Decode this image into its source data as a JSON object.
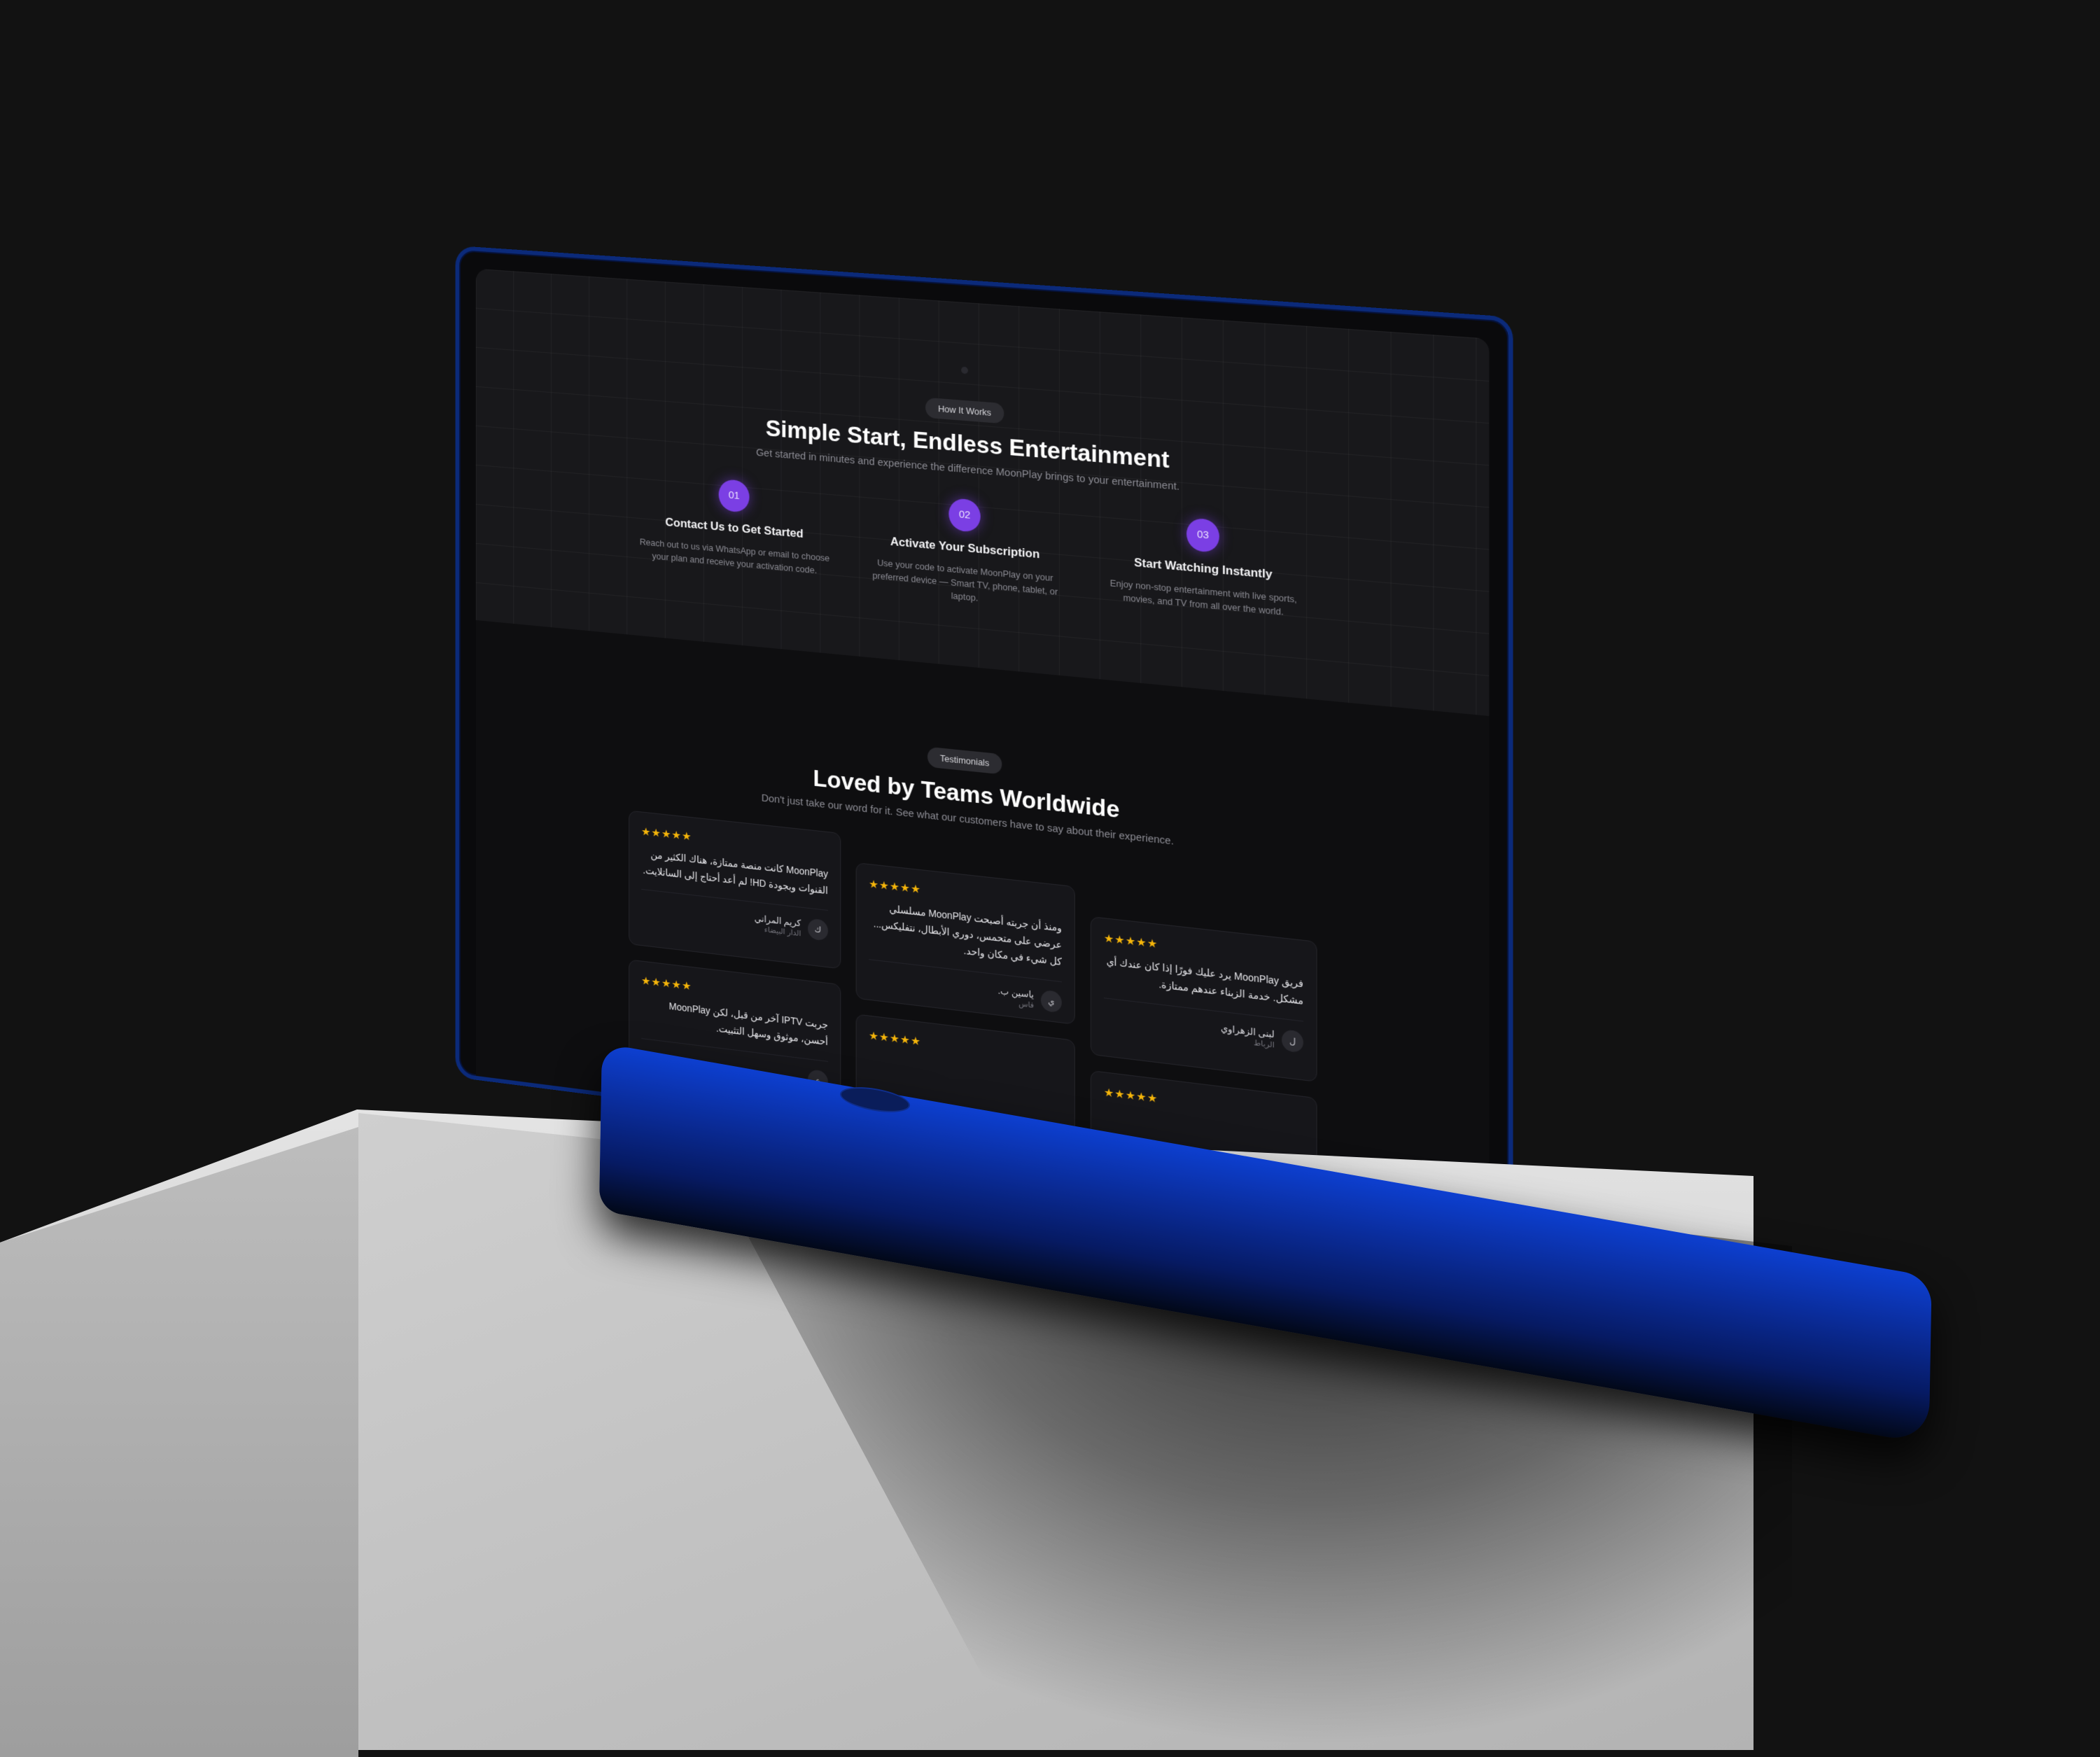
{
  "how_it_works": {
    "badge": "How It Works",
    "title": "Simple Start, Endless Entertainment",
    "subtitle": "Get started in minutes and experience the difference MoonPlay brings to your entertainment.",
    "steps": [
      {
        "number": "01",
        "title": "Contact Us to Get Started",
        "desc": "Reach out to us via WhatsApp or email to choose your plan and receive your activation code."
      },
      {
        "number": "02",
        "title": "Activate Your Subscription",
        "desc": "Use your code to activate MoonPlay on your preferred device — Smart TV, phone, tablet, or laptop."
      },
      {
        "number": "03",
        "title": "Start Watching Instantly",
        "desc": "Enjoy non-stop entertainment with live sports, movies, and TV from all over the world."
      }
    ]
  },
  "testimonials": {
    "badge": "Testimonials",
    "title": "Loved by Teams Worldwide",
    "subtitle": "Don't just take our word for it. See what our customers have to say about their experience.",
    "stars": "★★★★★",
    "cards": [
      {
        "quote": "MoonPlay كانت منصة ممتازة، هناك الكثير من القنوات وبجودة HD! لم أعد أحتاج إلى الساتلايت.",
        "avatar": "ك",
        "name": "كريم المراني",
        "location": "الدار البيضاء"
      },
      {
        "quote": "ومنذ أن جربته أصبحت MoonPlay مسلسلي عرضي على متحمس، دوري الأبطال، نتفليكس... كل شيء في مكان واحد.",
        "avatar": "ي",
        "name": "ياسين ب.",
        "location": "فاس"
      },
      {
        "quote": "فريق MoonPlay يرد عليك فورًا إذا كان عندك أي مشكل. خدمة الزبناء عندهم ممتازة.",
        "avatar": "ل",
        "name": "لبنى الزهراوي",
        "location": "الرباط"
      },
      {
        "quote": "جربت IPTV آخر من قبل، لكن MoonPlay أحسن، موثوق وسهل التثبيت.",
        "avatar": "ع",
        "name": "",
        "location": ""
      }
    ]
  },
  "colors": {
    "accent": "#7b3fe4",
    "laptop_body": "#0b2a7a",
    "stars": "#f5b50a"
  }
}
